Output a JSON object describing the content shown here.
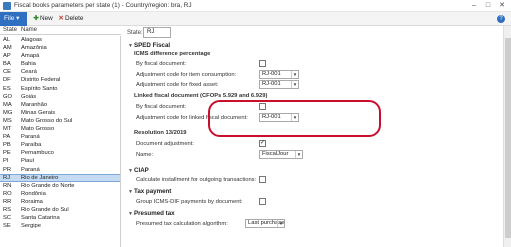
{
  "window": {
    "title": "Fiscal books parameters per state (1) - Country/region: bra, RJ",
    "minimize": "–",
    "maximize": "□",
    "close": "✕"
  },
  "toolbar": {
    "file_label": "File",
    "new_label": "New",
    "delete_label": "Delete",
    "help_icon": "?"
  },
  "list": {
    "header_state": "State",
    "header_name": "Name",
    "rows": [
      {
        "code": "AL",
        "name": "Alagoas"
      },
      {
        "code": "AM",
        "name": "Amazônia"
      },
      {
        "code": "AP",
        "name": "Amapá"
      },
      {
        "code": "BA",
        "name": "Bahia"
      },
      {
        "code": "CE",
        "name": "Ceará"
      },
      {
        "code": "DF",
        "name": "Distrito Federal"
      },
      {
        "code": "ES",
        "name": "Espírito Santo"
      },
      {
        "code": "GO",
        "name": "Goiás"
      },
      {
        "code": "MA",
        "name": "Maranhão"
      },
      {
        "code": "MG",
        "name": "Minas Gerais"
      },
      {
        "code": "MS",
        "name": "Mato Grosso do Sul"
      },
      {
        "code": "MT",
        "name": "Mato Grosso"
      },
      {
        "code": "PA",
        "name": "Paraná"
      },
      {
        "code": "PB",
        "name": "Paraíba"
      },
      {
        "code": "PE",
        "name": "Pernambuco"
      },
      {
        "code": "PI",
        "name": "Piauí"
      },
      {
        "code": "PR",
        "name": "Paraná"
      },
      {
        "code": "RJ",
        "name": "Rio de Janeiro"
      },
      {
        "code": "RN",
        "name": "Rio Grande do Norte"
      },
      {
        "code": "RO",
        "name": "Rondônia"
      },
      {
        "code": "RR",
        "name": "Roraima"
      },
      {
        "code": "RS",
        "name": "Rio Grande do Sul"
      },
      {
        "code": "SC",
        "name": "Santa Catarina"
      },
      {
        "code": "SE",
        "name": "Sergipe"
      }
    ],
    "selected": "RJ"
  },
  "detail": {
    "state_label": "State:",
    "state_value": "RJ",
    "sped_title": "SPED Fiscal",
    "icms_title": "ICMS difference percentage",
    "by_fiscal_doc": "By fiscal document:",
    "adj_item_label": "Adjustment code for item consumption:",
    "adj_item_value": "RJ-001",
    "adj_fixed_label": "Adjustment code for fixed asset:",
    "adj_fixed_value": "RJ-001",
    "linked_title": "Linked fiscal document (CFOPs 5.929 and 6.929)",
    "by_fiscal_doc2": "By fiscal document:",
    "adj_linked_label": "Adjustment code for linked fiscal document:",
    "adj_linked_value": "RJ-001",
    "resolution_title": "Resolution 13/2019",
    "doc_adj_label": "Document adjustment:",
    "doc_adj_check": "✓",
    "name_label": "Name:",
    "name_value": "FiscalJour",
    "ciap_title": "CIAP",
    "ciap_calc_label": "Calculate installment for outgoing transactions:",
    "tax_title": "Tax payment",
    "tax_group_label": "Group ICMS-DIF payments by document:",
    "presumed_title": "Presumed tax",
    "presumed_algo_label": "Presumed tax calculation algorithm:",
    "presumed_algo_value": "Last purchase"
  },
  "colors": {
    "accent": "#2f6fc2",
    "selection": "#c5dbf4",
    "highlight_ring": "#c8102e"
  }
}
